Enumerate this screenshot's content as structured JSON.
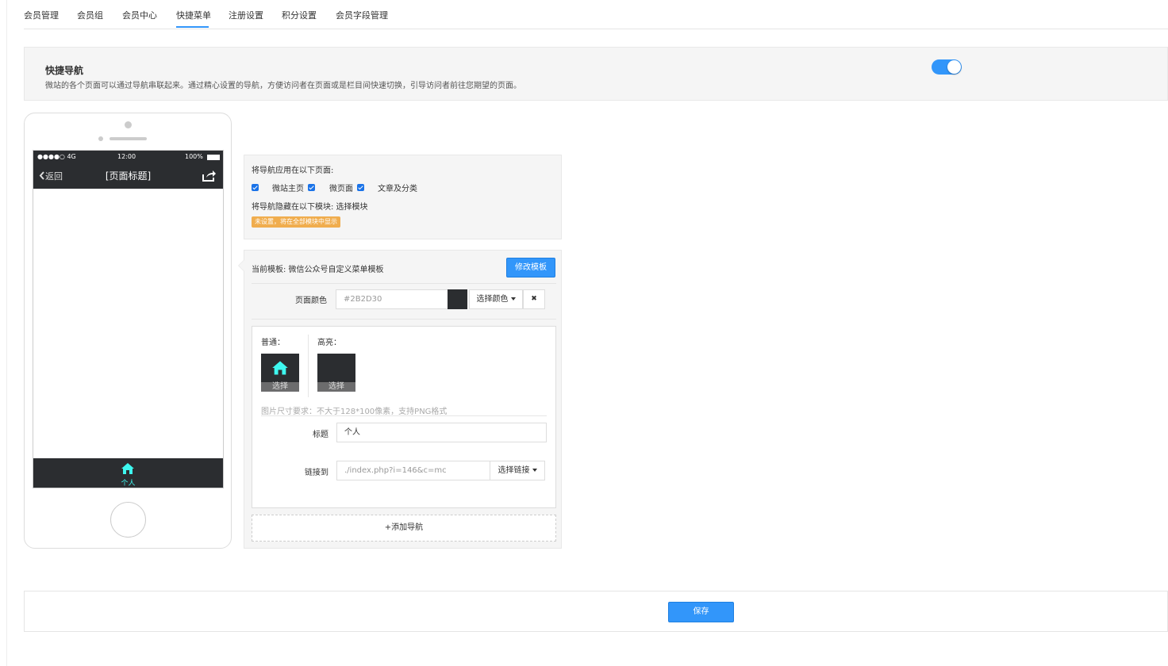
{
  "tabs": [
    "会员管理",
    "会员组",
    "会员中心",
    "快捷菜单",
    "注册设置",
    "积分设置",
    "会员字段管理"
  ],
  "active_tab": "快捷菜单",
  "banner": {
    "title": "快捷导航",
    "desc": "微站的各个页面可以通过导航串联起来。通过精心设置的导航，方便访问者在页面或是栏目间快速切换，引导访问者前往您期望的页面。",
    "enabled": true
  },
  "phone": {
    "signal": "●●●●○ 4G",
    "time": "12:00",
    "battery": "100%",
    "back": "返回",
    "title": "[页面标题]",
    "tab_label": "个人",
    "tab_color": "#3ef7ef"
  },
  "apply": {
    "label": "将导航应用在以下页面:",
    "options": [
      "微站主页",
      "微页面",
      "文章及分类"
    ],
    "hide_label": "将导航隐藏在以下模块: 选择模块",
    "warning": "未设置，将在全部模块中显示"
  },
  "template": {
    "current": "当前模板: 微信公众号自定义菜单模板",
    "modify_btn": "修改模板",
    "color_label": "页面颜色",
    "color_value": "#2B2D30",
    "choose_color": "选择颜色",
    "clear": "✖"
  },
  "item": {
    "normal_label": "普通：",
    "highlight_label": "高亮：",
    "select": "选择",
    "hint": "图片尺寸要求：不大于128*100像素，支持PNG格式",
    "title_label": "标题",
    "title_value": "个人",
    "link_label": "链接到",
    "link_value": "./index.php?i=146&c=mc",
    "choose_link": "选择链接"
  },
  "add_nav": "+添加导航",
  "save": "保存",
  "colors": {
    "accent": "#3296fa",
    "dark": "#2b2d30",
    "warning": "#f0ad4e",
    "icon": "#3ef7ef"
  }
}
